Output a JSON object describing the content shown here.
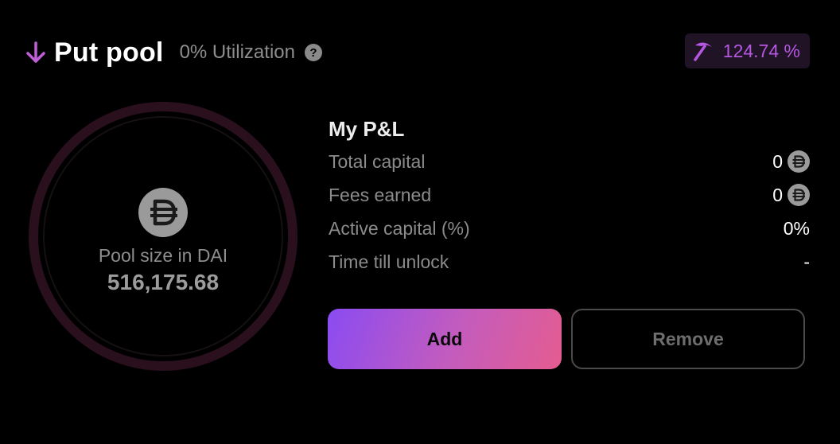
{
  "header": {
    "title": "Put pool",
    "utilization": "0% Utilization",
    "help": "?",
    "apy": "124.74 %"
  },
  "pool": {
    "label": "Pool size in DAI",
    "value": "516,175.68"
  },
  "pnl": {
    "title": "My P&L",
    "rows": [
      {
        "label": "Total capital",
        "value": "0",
        "icon": "dai-icon"
      },
      {
        "label": "Fees earned",
        "value": "0",
        "icon": "dai-icon"
      },
      {
        "label": "Active capital (%)",
        "value": "0%"
      },
      {
        "label": "Time till unlock",
        "value": "-"
      }
    ]
  },
  "buttons": {
    "add": "Add",
    "remove": "Remove"
  },
  "colors": {
    "accent_purple": "#b557e0",
    "ring": "#2a0f1c",
    "add_gradient_start": "#8a4bf2",
    "add_gradient_end": "#e45c90"
  }
}
